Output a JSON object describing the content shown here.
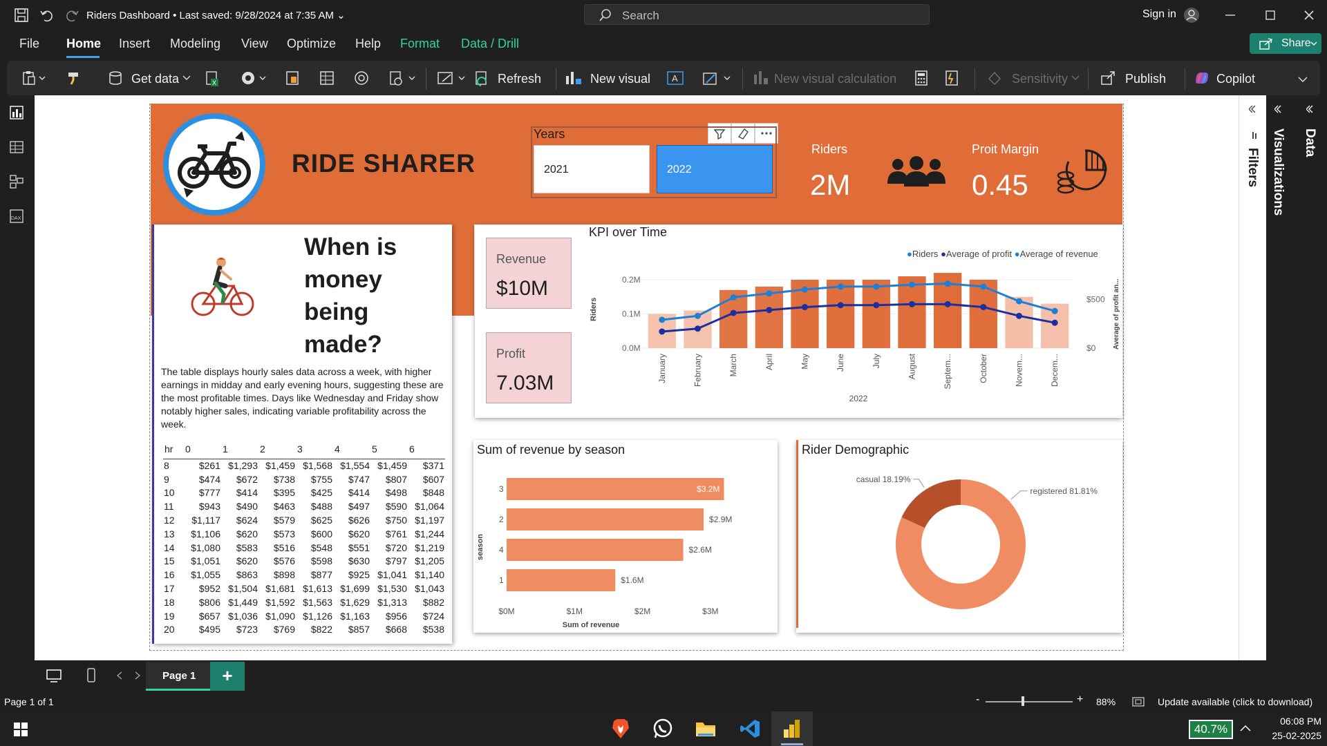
{
  "app": {
    "title": "Riders Dashboard",
    "saved": "• Last saved: 9/28/2024 at 7:35 AM",
    "search_placeholder": "Search",
    "sign_in": "Sign in"
  },
  "menu": [
    "File",
    "Home",
    "Insert",
    "Modeling",
    "View",
    "Optimize",
    "Help",
    "Format",
    "Data / Drill"
  ],
  "share_label": "Share",
  "ribbon": {
    "get_data": "Get data",
    "refresh": "Refresh",
    "new_visual": "New visual",
    "new_visual_calc": "New visual calculation",
    "sensitivity": "Sensitivity",
    "publish": "Publish",
    "copilot": "Copilot"
  },
  "panes": {
    "filters": "Filters",
    "visualizations": "Visualizations",
    "data": "Data"
  },
  "report": {
    "title": "RIDE SHARER",
    "years_label": "Years",
    "years": [
      "2021",
      "2022"
    ],
    "selected_year": "2022",
    "riders_label": "Riders",
    "riders_value": "2M",
    "pm_label": "Proit Margin",
    "pm_value": "0.45",
    "money_title": [
      "When is",
      "money",
      "being",
      "made?"
    ],
    "description": "The table displays hourly sales data across a week, with higher earnings in midday and early evening hours, suggesting these are the most profitable times. Days like Wednesday and Friday show notably higher sales, indicating variable profitability across the week.",
    "revenue_label": "Revenue",
    "revenue_value": "$10M",
    "profit_label": "Profit",
    "profit_value": "7.03M"
  },
  "hour_table": {
    "headers": [
      "hr",
      "0",
      "1",
      "2",
      "3",
      "4",
      "5",
      "6"
    ],
    "rows": [
      [
        "8",
        "$261",
        "$1,293",
        "$1,459",
        "$1,568",
        "$1,554",
        "$1,459",
        "$371"
      ],
      [
        "9",
        "$474",
        "$672",
        "$738",
        "$755",
        "$747",
        "$807",
        "$607"
      ],
      [
        "10",
        "$777",
        "$414",
        "$395",
        "$425",
        "$414",
        "$498",
        "$848"
      ],
      [
        "11",
        "$943",
        "$490",
        "$463",
        "$488",
        "$497",
        "$590",
        "$1,064"
      ],
      [
        "12",
        "$1,117",
        "$624",
        "$579",
        "$625",
        "$626",
        "$750",
        "$1,197"
      ],
      [
        "13",
        "$1,106",
        "$620",
        "$573",
        "$600",
        "$620",
        "$761",
        "$1,244"
      ],
      [
        "14",
        "$1,080",
        "$583",
        "$516",
        "$548",
        "$551",
        "$720",
        "$1,219"
      ],
      [
        "15",
        "$1,051",
        "$620",
        "$576",
        "$598",
        "$630",
        "$797",
        "$1,205"
      ],
      [
        "16",
        "$1,055",
        "$863",
        "$898",
        "$877",
        "$925",
        "$1,041",
        "$1,140"
      ],
      [
        "17",
        "$952",
        "$1,504",
        "$1,681",
        "$1,613",
        "$1,699",
        "$1,530",
        "$1,043"
      ],
      [
        "18",
        "$806",
        "$1,449",
        "$1,592",
        "$1,563",
        "$1,629",
        "$1,313",
        "$882"
      ],
      [
        "19",
        "$657",
        "$1,036",
        "$1,090",
        "$1,126",
        "$1,163",
        "$956",
        "$724"
      ],
      [
        "20",
        "$495",
        "$723",
        "$769",
        "$822",
        "$857",
        "$668",
        "$538"
      ]
    ]
  },
  "chart_data": [
    {
      "type": "bar",
      "title": "KPI over Time",
      "xlabel": "2022",
      "ylabel": "Riders",
      "y2label": "Average of profit an...",
      "categories": [
        "January",
        "February",
        "March",
        "April",
        "May",
        "June",
        "July",
        "August",
        "Septem...",
        "October",
        "Novem...",
        "Decem..."
      ],
      "ylim": [
        0,
        0.2
      ],
      "y_ticks": [
        "0.0M",
        "0.1M",
        "0.2M"
      ],
      "y2_ticks": [
        "$0",
        "$500"
      ],
      "y2lim": [
        0,
        700
      ],
      "series": [
        {
          "name": "Riders",
          "values": [
            0.1,
            0.11,
            0.17,
            0.18,
            0.2,
            0.2,
            0.2,
            0.21,
            0.22,
            0.2,
            0.15,
            0.13
          ]
        },
        {
          "name": "Average of profit",
          "values": [
            170,
            200,
            360,
            390,
            420,
            440,
            440,
            450,
            450,
            420,
            330,
            260
          ]
        },
        {
          "name": "Average of revenue",
          "values": [
            290,
            330,
            520,
            560,
            600,
            630,
            630,
            650,
            660,
            630,
            480,
            380
          ]
        }
      ],
      "colors": {
        "riders_dark": "#e06c38",
        "riders_light": "#f3b8a0",
        "profit": "#1b2fa0",
        "revenue": "#1f7fd6"
      }
    },
    {
      "type": "bar",
      "title": "Sum of revenue by season",
      "xlabel": "Sum of revenue",
      "ylabel": "season",
      "categories": [
        "3",
        "2",
        "4",
        "1"
      ],
      "values": [
        3.2,
        2.9,
        2.6,
        1.6
      ],
      "value_labels": [
        "$3.2M",
        "$2.9M",
        "$2.6M",
        "$1.6M"
      ],
      "x_ticks": [
        "$0M",
        "$1M",
        "$2M",
        "$3M"
      ],
      "xlim": [
        0,
        3.5
      ]
    },
    {
      "type": "pie",
      "title": "Rider Demographic",
      "categories": [
        "casual",
        "registered"
      ],
      "values": [
        18.19,
        81.81
      ],
      "labels": [
        "casual 18.19%",
        "registered 81.81%"
      ],
      "colors": [
        "#b5502a",
        "#ef8c62"
      ]
    }
  ],
  "tabs": {
    "page": "Page 1",
    "add": "+"
  },
  "status": {
    "page_of": "Page 1 of 1",
    "zoom": "88%",
    "update": "Update available (click to download)"
  },
  "taskbar": {
    "battery": "40.7%",
    "time": "06:08 PM",
    "date": "25-02-2025"
  }
}
